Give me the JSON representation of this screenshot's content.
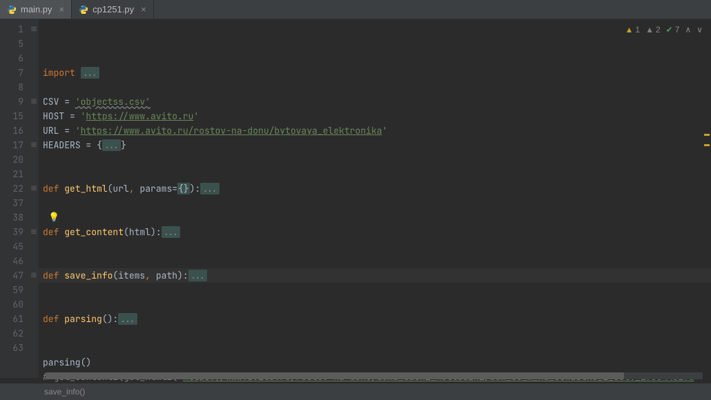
{
  "tabs": [
    {
      "label": "main.py",
      "active": true
    },
    {
      "label": "cp1251.py",
      "active": false
    }
  ],
  "inspections": {
    "warnings": "1",
    "weak_warnings": "2",
    "typos": "7"
  },
  "line_numbers": [
    "1",
    "5",
    "6",
    "7",
    "8",
    "9",
    "15",
    "16",
    "17",
    "20",
    "21",
    "22",
    "37",
    "38",
    "39",
    "45",
    "46",
    "47",
    "59",
    "60",
    "61",
    "62",
    "63"
  ],
  "fold_markers": {
    "0": "⊞",
    "5": "⊞",
    "8": "⊞",
    "11": "⊞",
    "14": "⊞",
    "17": "⊞"
  },
  "code": {
    "import_kw": "import",
    "csv_var": "CSV = ",
    "csv_val": "'objectss.csv'",
    "host_var": "HOST = ",
    "host_q": "'",
    "host_val": "https://www.avito.ru",
    "url_var": "URL = ",
    "url_val": "https://www.avito.ru/rostov-na-donu/bytovaya_elektronika",
    "headers_var": "HEADERS = {",
    "headers_close": "}",
    "def": "def",
    "fn_get_html": "get_html",
    "fn_get_html_args_open": "(url",
    "fn_get_html_args_mid": " params=",
    "fn_get_html_dict": "{}",
    "fn_get_html_close": "):",
    "fn_get_content": "get_content",
    "fn_get_content_args": "(html):",
    "fn_save_info": "save_info",
    "fn_save_info_args_open": "(items",
    "fn_save_info_args_close": " path):",
    "fn_parsing": "parsing",
    "fn_parsing_args": "():",
    "call_parsing": "parsing()",
    "comment_prefix": "# get_content1(get_html1(",
    "comment_q": "'",
    "comment_url": "https://www.avito.ru/rostov-na-donu/doma_dachi_kottedzhi/dom_35_m_na_uchastke_1_sot._1738448173",
    "ellipsis": "..."
  },
  "status": {
    "breadcrumb": "save_info()"
  }
}
